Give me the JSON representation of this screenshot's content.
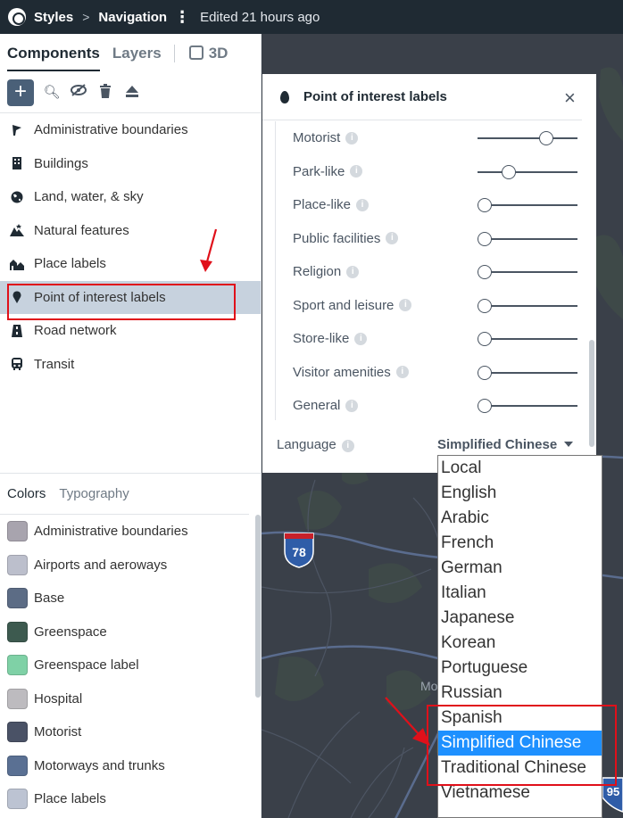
{
  "topbar": {
    "crumb1": "Styles",
    "crumb2": "Navigation",
    "edited": "Edited 21 hours ago",
    "sep": ">"
  },
  "left": {
    "tabs": {
      "components": "Components",
      "layers": "Layers",
      "three_d": "3D"
    },
    "components": [
      {
        "label": "Administrative boundaries",
        "icon": "flag-icon"
      },
      {
        "label": "Buildings",
        "icon": "building-icon"
      },
      {
        "label": "Land, water, & sky",
        "icon": "globe-icon"
      },
      {
        "label": "Natural features",
        "icon": "mountain-icon"
      },
      {
        "label": "Place labels",
        "icon": "houses-icon"
      },
      {
        "label": "Point of interest labels",
        "icon": "pin-icon",
        "selected": true
      },
      {
        "label": "Road network",
        "icon": "road-icon"
      },
      {
        "label": "Transit",
        "icon": "train-icon"
      }
    ],
    "subtabs": {
      "colors": "Colors",
      "typography": "Typography"
    },
    "colors": [
      {
        "label": "Administrative boundaries",
        "color": "#a8a4ae"
      },
      {
        "label": "Airports and aeroways",
        "color": "#bcbfcc"
      },
      {
        "label": "Base",
        "color": "#5c6c85"
      },
      {
        "label": "Greenspace",
        "color": "#3d5a4f"
      },
      {
        "label": "Greenspace label",
        "color": "#7fd1a6"
      },
      {
        "label": "Hospital",
        "color": "#bdbbbf"
      },
      {
        "label": "Motorist",
        "color": "#4a5266"
      },
      {
        "label": "Motorways and trunks",
        "color": "#5a7093"
      },
      {
        "label": "Place labels",
        "color": "#bcc3d2"
      }
    ]
  },
  "poi": {
    "title": "Point of interest labels",
    "close": "×",
    "rows": [
      {
        "label": "Motorist",
        "value": 0.72
      },
      {
        "label": "Park-like",
        "value": 0.28
      },
      {
        "label": "Place-like",
        "value": 0
      },
      {
        "label": "Public facilities",
        "value": 0
      },
      {
        "label": "Religion",
        "value": 0
      },
      {
        "label": "Sport and leisure",
        "value": 0
      },
      {
        "label": "Store-like",
        "value": 0
      },
      {
        "label": "Visitor amenities",
        "value": 0
      },
      {
        "label": "General",
        "value": 0
      }
    ],
    "language_label": "Language",
    "language_value": "Simplified Chinese"
  },
  "language_options": [
    "Local",
    "English",
    "Arabic",
    "French",
    "German",
    "Italian",
    "Japanese",
    "Korean",
    "Portuguese",
    "Russian",
    "Spanish",
    "Simplified Chinese",
    "Traditional Chinese",
    "Vietnamese"
  ],
  "highlighted_option": "Simplified Chinese",
  "map": {
    "shield1": "78",
    "shield2": "95",
    "place_fragment": "Mo"
  }
}
